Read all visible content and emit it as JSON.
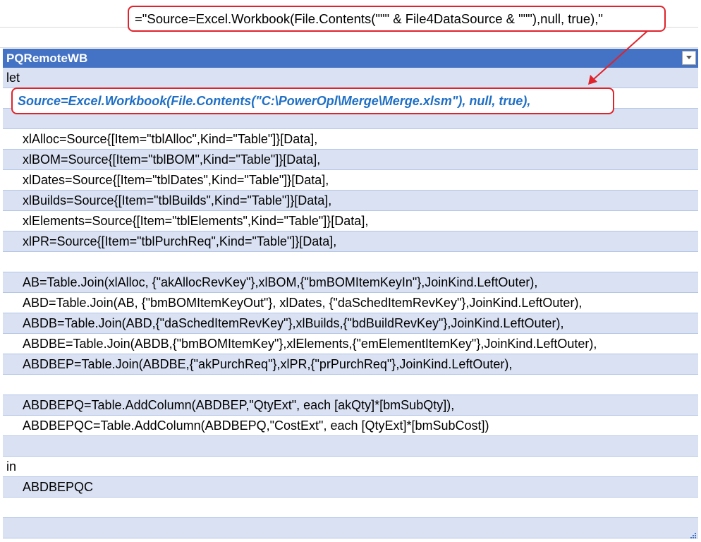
{
  "callout_formula": "=\"Source=Excel.Workbook(File.Contents(\"\"\" & File4DataSource & \"\"\"),null, true),\"",
  "table": {
    "name": "PQRemoteWB",
    "source_line": "Source=Excel.Workbook(File.Contents(\"C:\\PowerOpl\\Merge\\Merge.xlsm\"), null, true),",
    "rows": [
      {
        "text": "let",
        "indent": false
      },
      {
        "text": "",
        "indent": true
      },
      {
        "text": "",
        "indent": true
      },
      {
        "text": "xlAlloc=Source{[Item=\"tblAlloc\",Kind=\"Table\"]}[Data],",
        "indent": true
      },
      {
        "text": "xlBOM=Source{[Item=\"tblBOM\",Kind=\"Table\"]}[Data],",
        "indent": true
      },
      {
        "text": "xlDates=Source{[Item=\"tblDates\",Kind=\"Table\"]}[Data],",
        "indent": true
      },
      {
        "text": "xlBuilds=Source{[Item=\"tblBuilds\",Kind=\"Table\"]}[Data],",
        "indent": true
      },
      {
        "text": "xlElements=Source{[Item=\"tblElements\",Kind=\"Table\"]}[Data],",
        "indent": true
      },
      {
        "text": "xlPR=Source{[Item=\"tblPurchReq\",Kind=\"Table\"]}[Data],",
        "indent": true
      },
      {
        "text": "",
        "indent": true
      },
      {
        "text": "AB=Table.Join(xlAlloc, {\"akAllocRevKey\"},xlBOM,{\"bmBOMItemKeyIn\"},JoinKind.LeftOuter),",
        "indent": true
      },
      {
        "text": "ABD=Table.Join(AB, {\"bmBOMItemKeyOut\"}, xlDates, {\"daSchedItemRevKey\"},JoinKind.LeftOuter),",
        "indent": true
      },
      {
        "text": "ABDB=Table.Join(ABD,{\"daSchedItemRevKey\"},xlBuilds,{\"bdBuildRevKey\"},JoinKind.LeftOuter),",
        "indent": true
      },
      {
        "text": "ABDBE=Table.Join(ABDB,{\"bmBOMItemKey\"},xlElements,{\"emElementItemKey\"},JoinKind.LeftOuter),",
        "indent": true
      },
      {
        "text": "ABDBEP=Table.Join(ABDBE,{\"akPurchReq\"},xlPR,{\"prPurchReq\"},JoinKind.LeftOuter),",
        "indent": true
      },
      {
        "text": "",
        "indent": true
      },
      {
        "text": "ABDBEPQ=Table.AddColumn(ABDBEP,\"QtyExt\", each [akQty]*[bmSubQty]),",
        "indent": true
      },
      {
        "text": "ABDBEPQC=Table.AddColumn(ABDBEPQ,\"CostExt\", each [QtyExt]*[bmSubCost])",
        "indent": true
      },
      {
        "text": "",
        "indent": true
      },
      {
        "text": "in",
        "indent": false
      },
      {
        "text": "ABDBEPQC",
        "indent": true
      },
      {
        "text": "",
        "indent": true
      },
      {
        "text": "",
        "indent": true
      }
    ]
  },
  "colors": {
    "header_bg": "#4472c4",
    "band_bg": "#d9e1f2",
    "highlight_border": "#e0222a",
    "source_text": "#1f6fc5"
  },
  "icons": {
    "filter": "chevron-down-icon",
    "arrow": "arrow-icon",
    "resize": "resize-grip-icon"
  }
}
